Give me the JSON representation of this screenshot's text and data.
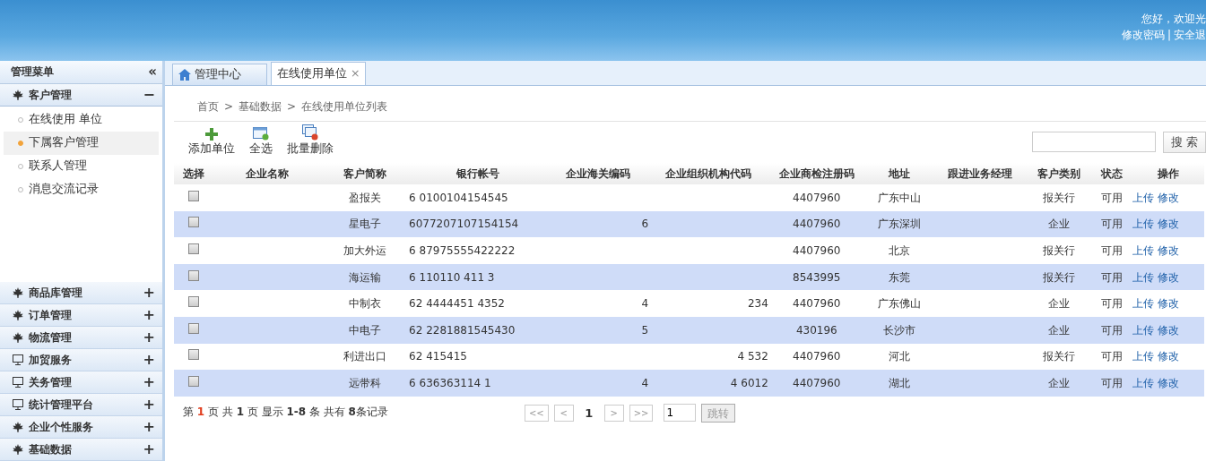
{
  "header": {
    "greeting": "您好，欢迎光",
    "links": [
      "修改密码",
      "安全退"
    ],
    "separator": "|"
  },
  "sidebar": {
    "title": "管理菜单",
    "collapse": "«",
    "groups": [
      {
        "label": "客户管理",
        "kind": "leaf",
        "expanded": true,
        "toggle": "−",
        "items": [
          {
            "label": "在线使用 单位",
            "selected": false
          },
          {
            "label": "下属客户管理",
            "selected": true
          },
          {
            "label": "联系人管理",
            "selected": false
          },
          {
            "label": "消息交流记录",
            "selected": false
          }
        ]
      },
      {
        "label": "商品库管理",
        "kind": "leaf",
        "expanded": false,
        "toggle": "+"
      },
      {
        "label": "订单管理",
        "kind": "leaf",
        "expanded": false,
        "toggle": "+"
      },
      {
        "label": "物流管理",
        "kind": "leaf",
        "expanded": false,
        "toggle": "+"
      },
      {
        "label": "加贸服务",
        "kind": "monitor",
        "expanded": false,
        "toggle": "+"
      },
      {
        "label": "关务管理",
        "kind": "monitor",
        "expanded": false,
        "toggle": "+"
      },
      {
        "label": "统计管理平台",
        "kind": "monitor",
        "expanded": false,
        "toggle": "+"
      },
      {
        "label": "企业个性服务",
        "kind": "leaf",
        "expanded": false,
        "toggle": "+"
      },
      {
        "label": "基础数据",
        "kind": "leaf",
        "expanded": false,
        "toggle": "+"
      }
    ]
  },
  "tabs": [
    {
      "label": "管理中心",
      "selected": false,
      "kind": "home"
    },
    {
      "label": "在线使用单位",
      "selected": true,
      "kind": "closable",
      "close": "×"
    }
  ],
  "breadcrumb": {
    "items": [
      "首页",
      "基础数据",
      "在线使用单位列表"
    ],
    "separators": [
      ">",
      ">"
    ]
  },
  "toolbar": [
    {
      "label": "添加单位",
      "kind": "add"
    },
    {
      "label": "全选",
      "kind": "select"
    },
    {
      "label": "批量删除",
      "kind": "delete"
    }
  ],
  "search": {
    "button": "搜 索"
  },
  "table": {
    "columns": [
      "选择",
      "企业名称",
      "客户简称",
      "银行帐号",
      "企业海关编码",
      "企业组织机构代码",
      "企业商检注册码",
      "地址",
      "跟进业务经理",
      "客户类别",
      "状态",
      "操作"
    ],
    "rows": [
      {
        "checked": false,
        "short": "盈报关",
        "bank": "6 0100104154545",
        "customs": "",
        "org": "",
        "insp": "4407960",
        "addr": "广东中山",
        "cat": "报关行",
        "status": "可用",
        "actions": [
          "上传",
          "修改"
        ]
      },
      {
        "checked": false,
        "short": "星电子",
        "bank": "6077207107154154",
        "customs": "6",
        "org": "",
        "insp": "4407960",
        "addr": "广东深圳",
        "cat": "企业",
        "status": "可用",
        "actions": [
          "上传",
          "修改"
        ]
      },
      {
        "checked": false,
        "short": "加大外运",
        "bank": "6 87975555422222",
        "customs": "",
        "org": "",
        "insp": "4407960",
        "addr": "北京",
        "cat": "报关行",
        "status": "可用",
        "actions": [
          "上传",
          "修改"
        ]
      },
      {
        "checked": false,
        "short": "海运输",
        "bank": "6 110110 411 3",
        "customs": "",
        "org": "",
        "insp": "8543995",
        "addr": "东莞",
        "cat": "报关行",
        "status": "可用",
        "actions": [
          "上传",
          "修改"
        ]
      },
      {
        "checked": false,
        "short": "中制衣",
        "bank": "62 4444451 4352",
        "customs": "4",
        "org": "234",
        "insp": "4407960",
        "addr": "广东佛山",
        "cat": "企业",
        "status": "可用",
        "actions": [
          "上传",
          "修改"
        ]
      },
      {
        "checked": false,
        "short": "中电子",
        "bank": "62 2281881545430",
        "customs": "5",
        "org": "",
        "insp": "430196",
        "addr": "长沙市",
        "cat": "企业",
        "status": "可用",
        "actions": [
          "上传",
          "修改"
        ]
      },
      {
        "checked": false,
        "short": "利进出口",
        "bank": "62 415415",
        "customs": "",
        "org": "4 532",
        "insp": "4407960",
        "addr": "河北",
        "cat": "报关行",
        "status": "可用",
        "actions": [
          "上传",
          "修改"
        ]
      },
      {
        "checked": false,
        "short": "远带科",
        "bank": "6 636363114 1",
        "customs": "4",
        "org": "4 6012",
        "insp": "4407960",
        "addr": "湖北",
        "cat": "企业",
        "status": "可用",
        "actions": [
          "上传",
          "修改"
        ]
      }
    ]
  },
  "summary": "第 **1** 页 共 **1** 页 显示 **1-8** 条 共有 **8**条记录",
  "pager": {
    "buttons": [
      "<<",
      "<",
      "1",
      ">",
      ">>"
    ],
    "page_input": "1",
    "go": "跳转"
  }
}
